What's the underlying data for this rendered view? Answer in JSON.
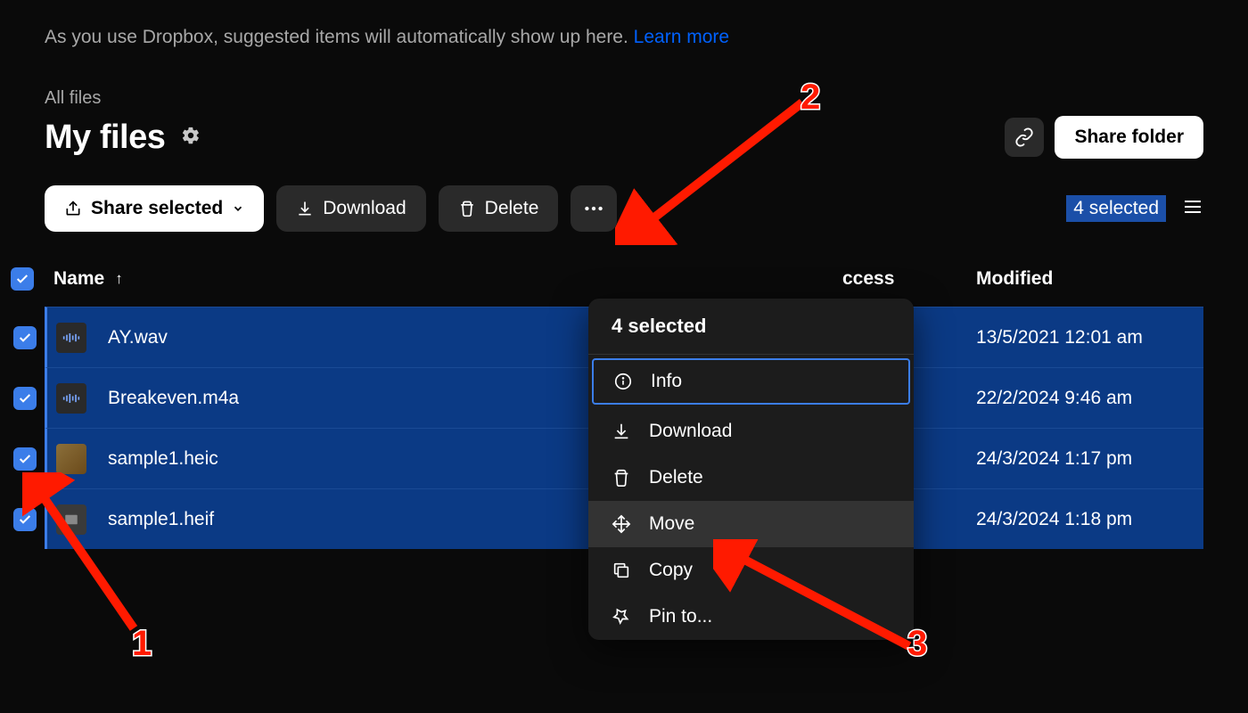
{
  "hint": {
    "text": "As you use Dropbox, suggested items will automatically show up here. ",
    "link": "Learn more"
  },
  "breadcrumb": "All files",
  "title": "My files",
  "share_folder": "Share folder",
  "toolbar": {
    "share_selected": "Share selected",
    "download": "Download",
    "delete": "Delete"
  },
  "selection_count_badge": "4 selected",
  "columns": {
    "name": "Name",
    "access": "ccess",
    "modified": "Modified"
  },
  "files": [
    {
      "name": "AY.wav",
      "modified": "13/5/2021 12:01 am",
      "icon": "audio"
    },
    {
      "name": "Breakeven.m4a",
      "modified": "22/2/2024 9:46 am",
      "icon": "audio"
    },
    {
      "name": "sample1.heic",
      "modified": "24/3/2024 1:17 pm",
      "icon": "img"
    },
    {
      "name": "sample1.heif",
      "modified": "24/3/2024 1:18 pm",
      "icon": "heif"
    }
  ],
  "menu": {
    "header": "4 selected",
    "items": {
      "info": "Info",
      "download": "Download",
      "delete": "Delete",
      "move": "Move",
      "copy": "Copy",
      "pin": "Pin to..."
    }
  },
  "annotations": {
    "one": "1",
    "two": "2",
    "three": "3"
  }
}
